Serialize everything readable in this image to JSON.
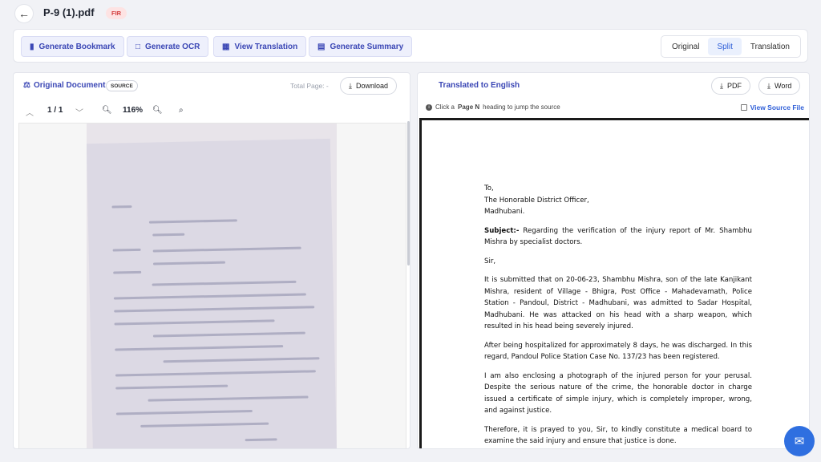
{
  "header": {
    "file_name": "P-9 (1).pdf",
    "badge": "FIR"
  },
  "toolbar": {
    "bookmark": "Generate Bookmark",
    "ocr": "Generate OCR",
    "view_translation": "View Translation",
    "summary": "Generate Summary",
    "views": [
      "Original",
      "Split",
      "Translation"
    ],
    "active_view": "Split"
  },
  "left": {
    "title": "Original Document",
    "source_badge": "SOURCE",
    "total_page": "Total Page: -",
    "download": "Download",
    "page": "1 / 1",
    "zoom": "116%"
  },
  "right": {
    "title": "Translated to English",
    "pdf": "PDF",
    "word": "Word",
    "hint_pre": "Click a ",
    "hint_bold": "Page N",
    "hint_post": " heading to jump the source",
    "view_source": "View Source File"
  },
  "translation": {
    "to": "To,",
    "addr1": "The Honorable District Officer,",
    "addr2": "Madhubani.",
    "subject_label": "Subject:-",
    "subject": " Regarding the verification of the injury report of Mr. Shambhu Mishra by specialist doctors.",
    "salutation": "Sir,",
    "p1": "It is submitted that on 20-06-23, Shambhu Mishra, son of the late Kanjikant Mishra, resident of Village - Bhigra, Post Office - Mahadevamath, Police Station - Pandoul, District - Madhubani, was admitted to Sadar Hospital, Madhubani. He was attacked on his head with a sharp weapon, which resulted in his head being severely injured.",
    "p2": "After being hospitalized for approximately 8 days, he was discharged. In this regard, Pandoul Police Station Case No. 137/23 has been registered.",
    "p3": "I am also enclosing a photograph of the injured person for your perusal. Despite the serious nature of the crime, the honorable doctor in charge issued a certificate of simple injury, which is completely improper, wrong, and against justice.",
    "p4": "Therefore, it is prayed to you, Sir, to kindly constitute a medical board to examine the said injury and ensure that justice is done."
  },
  "colors": {
    "accent": "#3b47b5",
    "link": "#2f5fd8",
    "badge_bg": "#fde3e3",
    "badge_fg": "#d23b3b",
    "chat": "#2f6fe0"
  }
}
